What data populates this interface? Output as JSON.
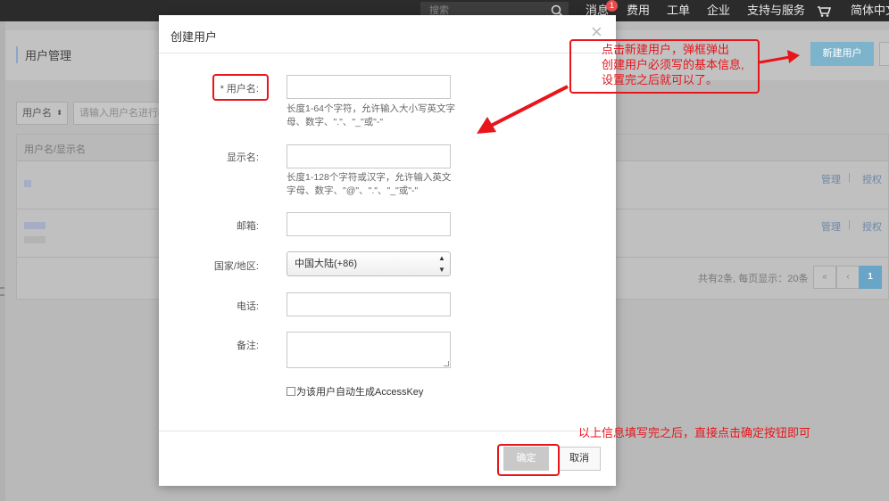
{
  "topbar": {
    "search_placeholder": "搜索",
    "messages_label": "消息",
    "messages_badge": "1",
    "nav_items": [
      "费用",
      "工单",
      "企业",
      "支持与服务",
      "简体中文"
    ]
  },
  "page": {
    "title": "用户管理",
    "new_user_button": "新建用户",
    "filter_select": "用户名",
    "filter_placeholder": "请输入用户名进行模",
    "table_header": "用户名/显示名",
    "row_actions": [
      "管理",
      "授权"
    ],
    "separator": "|",
    "pager_text": "共有2条, 每页显示：20条",
    "pager_buttons": [
      "«",
      "‹",
      "1"
    ]
  },
  "modal": {
    "title": "创建用户",
    "close": "×",
    "fields": {
      "username_label": "* 用户名:",
      "username_hint": "长度1-64个字符，允许输入大小写英文字母、数字、\".\"、\"_\"或\"-\"",
      "display_label": "显示名:",
      "display_hint": "长度1-128个字符或汉字，允许输入英文字母、数字、\"@\"、\".\"、\"_\"或\"-\"",
      "email_label": "邮箱:",
      "country_label": "国家/地区:",
      "country_value": "中国大陆(+86)",
      "phone_label": "电话:",
      "note_label": "备注:",
      "accesskey_label": "为该用户自动生成AccessKey"
    },
    "ok_button": "确定",
    "cancel_button": "取消"
  },
  "annotations": {
    "top_note_lines": [
      "点击新建用户，弹框弹出",
      "创建用户必须写的基本信息,",
      "设置完之后就可以了。"
    ],
    "bottom_note": "以上信息填写完之后，直接点击确定按钮即可",
    "color": "#e8151b"
  }
}
